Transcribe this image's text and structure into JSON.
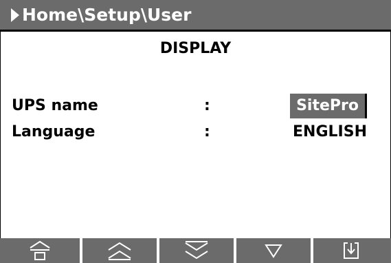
{
  "header": {
    "path": "Home\\Setup\\User"
  },
  "page": {
    "title": "DISPLAY"
  },
  "settings": [
    {
      "label": "UPS name",
      "separator": ":",
      "value": "SitePro",
      "selected": true
    },
    {
      "label": "Language",
      "separator": ":",
      "value": "ENGLISH",
      "selected": false
    }
  ],
  "toolbar": {
    "buttons": [
      {
        "icon": "home-icon"
      },
      {
        "icon": "page-up-icon"
      },
      {
        "icon": "page-down-icon"
      },
      {
        "icon": "down-icon"
      },
      {
        "icon": "enter-icon"
      }
    ]
  },
  "colors": {
    "header_bg": "#6b6b6b",
    "text": "#000000",
    "header_text": "#ffffff"
  }
}
